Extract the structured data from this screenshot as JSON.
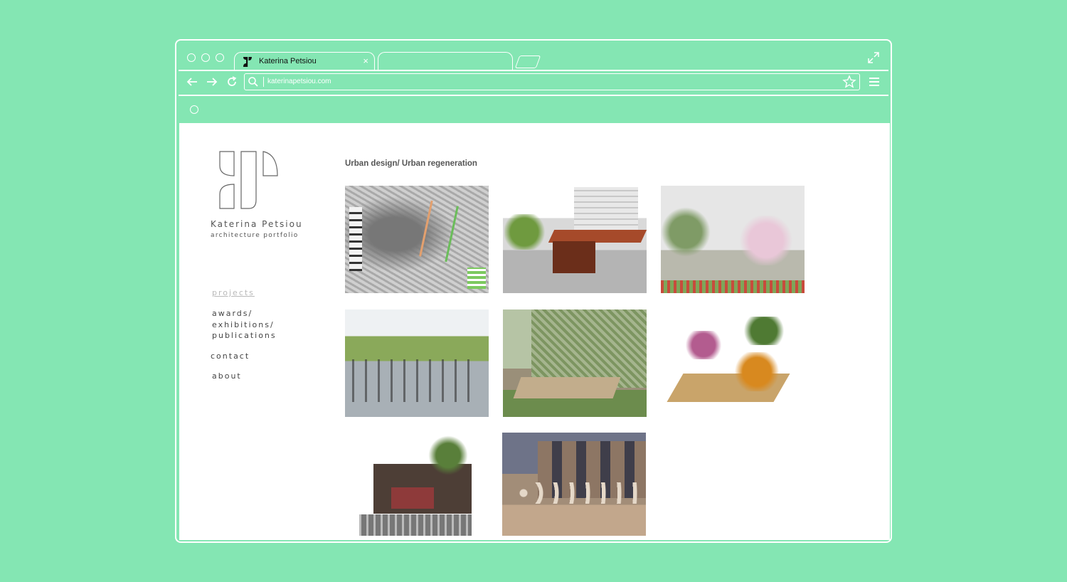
{
  "browser": {
    "tab_title": "Katerina Petsiou",
    "tab_close": "×",
    "url": "katerinapetsiou.com"
  },
  "site": {
    "brand_name": "Katerina Petsiou",
    "brand_subtitle": "architecture portfolio",
    "nav": {
      "projects": "projects",
      "awards": "awards/\nexhibitions/\npublications",
      "contact": "contact",
      "about": "about"
    },
    "section_title": "Urban design/ Urban regeneration",
    "gallery_count": 8
  },
  "colors": {
    "background": "#84e6b3",
    "chrome_line": "#ffffff",
    "page": "#ffffff",
    "nav_active": "#b9b9b9"
  },
  "icons": [
    "back-arrow-icon",
    "forward-arrow-icon",
    "reload-icon",
    "search-icon",
    "star-icon",
    "menu-icon",
    "expand-icon",
    "close-icon",
    "site-logo-icon"
  ]
}
